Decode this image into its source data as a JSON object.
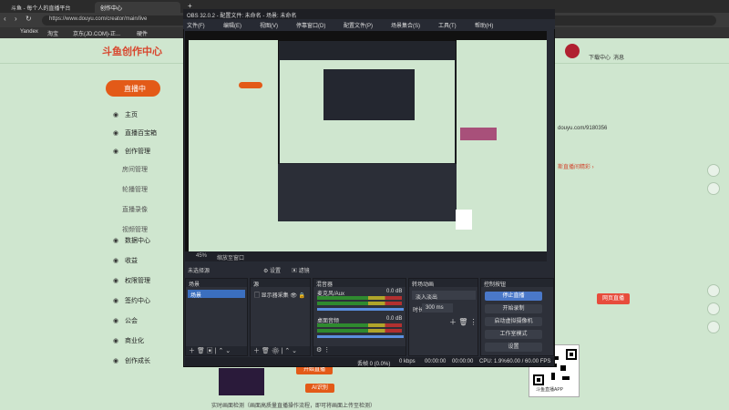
{
  "browser": {
    "tabs": [
      {
        "label": "斗鱼 - 每个人的直播平台",
        "active": false
      },
      {
        "label": "创作中心",
        "active": true
      }
    ],
    "new_tab_symbol": "+",
    "address": "https://www.douyu.com/creator/main/live",
    "bookmarks": [
      "Yandex",
      "淘宝",
      "京东(JD.COM)-正...",
      "硬件"
    ]
  },
  "page": {
    "logo_text": "斗鱼创作中心",
    "live_button": "直播中",
    "nav_items": [
      {
        "label": "主页",
        "icon": "home-icon"
      },
      {
        "label": "直播百宝箱",
        "icon": "toolbox-icon"
      },
      {
        "label": "创作管理",
        "icon": "create-icon"
      }
    ],
    "sub_items": [
      "房间管理",
      "轮播管理",
      "直播录像",
      "视频管理"
    ],
    "nav_items2": [
      {
        "label": "数据中心",
        "icon": "data-icon"
      },
      {
        "label": "收益",
        "icon": "income-icon"
      },
      {
        "label": "权限管理",
        "icon": "permission-icon"
      },
      {
        "label": "签约中心",
        "icon": "contract-icon"
      },
      {
        "label": "公会",
        "icon": "guild-icon"
      },
      {
        "label": "商业化",
        "icon": "commerce-icon"
      },
      {
        "label": "创作成长",
        "icon": "growth-icon"
      }
    ],
    "header_right": {
      "download": "下载中心",
      "message": "消息"
    },
    "room_id": "douyu.com/9180356",
    "notice": "斯直播间精彩 ›",
    "live_room_button": "网页直播",
    "qr_label": "斗鱼直播APP",
    "bottom_tip": "实时画面检测（画面高质量直播操作流程，即可将画面上传至检测）",
    "ai_label": "AI识别",
    "open_btn": "开始直播"
  },
  "obs": {
    "title": "OBS 32.0.2 - 配置文件: 未命名 - 场景: 未命名",
    "menu": [
      "文件(F)",
      "编辑(E)",
      "视图(V)",
      "停靠窗口(D)",
      "配置文件(P)",
      "场景集合(S)",
      "工具(T)",
      "帮助(H)"
    ],
    "zoom": "45%",
    "zoom_mode": "缩放至窗口",
    "no_source": "未选择源",
    "props_button": "设置",
    "filters_button": "滤镜",
    "docks": {
      "scenes": {
        "title": "场景",
        "selected": "场景"
      },
      "sources": {
        "title": "源",
        "item": "显示器采集"
      },
      "mixer": {
        "title": "混音器",
        "ch1": "麦克风/Aux",
        "ch1_db": "0.0 dB",
        "ch2": "桌面音频",
        "ch2_db": "0.0 dB"
      },
      "transitions": {
        "title": "转场动画",
        "type": "淡入淡出",
        "duration_label": "时长",
        "duration": "300 ms"
      },
      "controls": {
        "title": "控制按钮",
        "buttons": [
          "停止直播",
          "开始录制",
          "启动虚拟摄像机",
          "工作室模式",
          "设置"
        ]
      }
    },
    "status": {
      "dropped": "丢帧 0 (0.0%)",
      "bitrate": "0 kbps",
      "stream_time": "00:00:00",
      "rec_time": "00:00:00",
      "cpu": "CPU: 1.9%",
      "fps": "60.00 / 60.00 FPS"
    }
  }
}
